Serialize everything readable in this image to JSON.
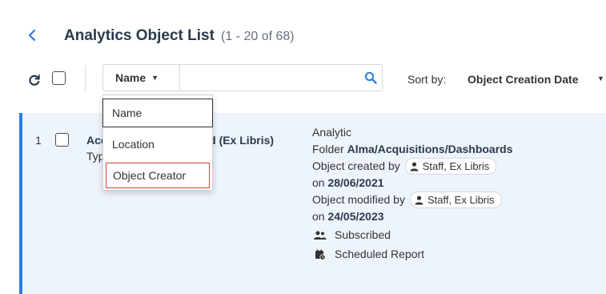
{
  "header": {
    "title": "Analytics Object List",
    "count": "(1 - 20 of 68)"
  },
  "toolbar": {
    "search_field": "Name",
    "search_value": "",
    "sort_label": "Sort by:",
    "sort_value": "Object Creation Date"
  },
  "dropdown": {
    "options": [
      "Name",
      "Location",
      "Object Creator"
    ]
  },
  "row": {
    "index": "1",
    "name_start": "Acc",
    "name_end": "rd (Ex Libris)",
    "type_prefix": "Typ",
    "kind": "Analytic",
    "folder_label": "Folder",
    "folder_path": "Alma/Acquisitions/Dashboards",
    "created_label": "Object created by",
    "created_by": "Staff, Ex Libris",
    "created_on_label": "on",
    "created_on": "28/06/2021",
    "modified_label": "Object modified by",
    "modified_by": "Staff, Ex Libris",
    "modified_on_label": "on",
    "modified_on": "24/05/2023",
    "subscribed": "Subscribed",
    "scheduled": "Scheduled Report"
  },
  "icons": {
    "back": "chevron-left-icon",
    "refresh": "refresh-icon",
    "search": "search-icon",
    "person": "person-icon",
    "subscribed": "users-icon",
    "scheduled": "calendar-clock-icon"
  },
  "colors": {
    "accent": "#2b7de9",
    "row_bg": "#eef4fb",
    "highlight_border": "#d9413a"
  }
}
